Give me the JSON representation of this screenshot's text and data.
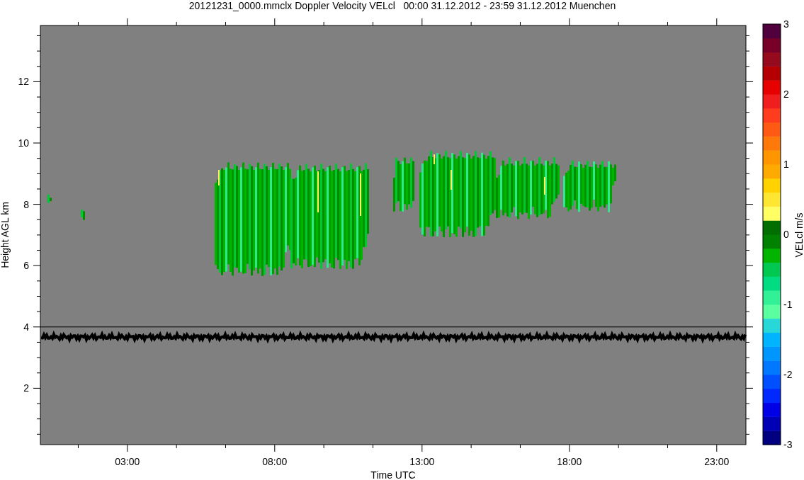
{
  "title": "20121231_0000.mmclx Doppler Velocity VELcl   00:00 31.12.2012 - 23:59 31.12.2012 Muenchen",
  "y_axis": {
    "label": "Height AGL km",
    "ticks": [
      "12",
      "10",
      "8",
      "6",
      "4",
      "2"
    ]
  },
  "x_axis": {
    "label": "Time UTC",
    "ticks": [
      "03:00",
      "08:00",
      "13:00",
      "18:00",
      "23:00"
    ]
  },
  "colorbar": {
    "label": "VELcl m/s",
    "ticks": [
      "3",
      "2",
      "1",
      "0",
      "-1",
      "-2",
      "-3"
    ]
  }
}
